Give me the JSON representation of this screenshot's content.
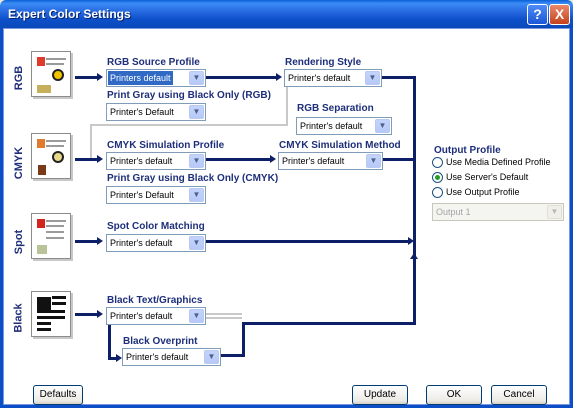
{
  "window": {
    "title": "Expert Color Settings",
    "help_glyph": "?",
    "close_glyph": "X"
  },
  "sections": {
    "rgb": "RGB",
    "cmyk": "CMYK",
    "spot": "Spot",
    "black": "Black"
  },
  "rgb": {
    "source_label": "RGB Source Profile",
    "source_value": "Printers default",
    "gray_label": "Print Gray using Black Only (RGB)",
    "gray_value": "Printer's Default",
    "rendering_label": "Rendering Style",
    "rendering_value": "Printer's default",
    "separation_label": "RGB Separation",
    "separation_value": "Printer's default"
  },
  "cmyk": {
    "sim_label": "CMYK Simulation Profile",
    "sim_value": "Printer's default",
    "method_label": "CMYK Simulation Method",
    "method_value": "Printer's default",
    "gray_label": "Print Gray using Black Only (CMYK)",
    "gray_value": "Printer's Default"
  },
  "spot": {
    "label": "Spot Color Matching",
    "value": "Printer's default"
  },
  "black": {
    "text_label": "Black Text/Graphics",
    "text_value": "Printer's default",
    "overprint_label": "Black Overprint",
    "overprint_value": "Printer's default"
  },
  "output": {
    "title": "Output Profile",
    "options": [
      {
        "label": "Use Media Defined Profile",
        "checked": false
      },
      {
        "label": "Use Server's Default",
        "checked": true
      },
      {
        "label": "Use Output Profile",
        "checked": false
      }
    ],
    "profile_value": "Output 1"
  },
  "buttons": {
    "defaults": "Defaults",
    "update": "Update",
    "ok": "OK",
    "cancel": "Cancel"
  },
  "dropdown_arrow": "▼",
  "colors": {
    "wire": "#0d1f66",
    "label": "#1e2f7a",
    "title_bar": "#0b4ec5"
  }
}
